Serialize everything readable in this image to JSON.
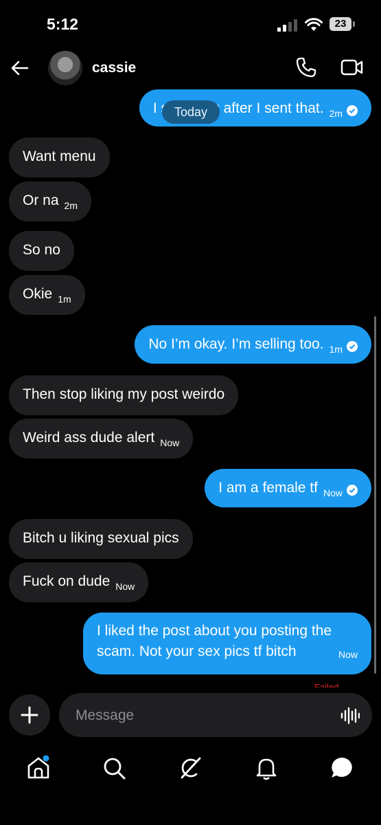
{
  "status_bar": {
    "time": "5:12",
    "battery": "23"
  },
  "header": {
    "contact_name": "cassie"
  },
  "date_divider": "Today",
  "messages": [
    {
      "dir": "out",
      "text": "I seen you after I sent that.",
      "time": "2m",
      "read": true
    },
    {
      "dir": "in",
      "text": "Want menu",
      "time": ""
    },
    {
      "dir": "in",
      "text": "Or na",
      "time": "2m"
    },
    {
      "dir": "in",
      "text": "So no",
      "time": ""
    },
    {
      "dir": "in",
      "text": "Okie",
      "time": "1m"
    },
    {
      "dir": "out",
      "text": "No I’m okay. I’m selling too.",
      "time": "1m",
      "read": true
    },
    {
      "dir": "in",
      "text": "Then stop liking my post weirdo",
      "time": ""
    },
    {
      "dir": "in",
      "text": "Weird ass dude alert",
      "time": "Now"
    },
    {
      "dir": "out",
      "text": "I am a female tf",
      "time": "Now",
      "read": true
    },
    {
      "dir": "in",
      "text": "Bitch u liking sexual pics",
      "time": ""
    },
    {
      "dir": "in",
      "text": "Fuck on dude",
      "time": "Now"
    },
    {
      "dir": "out",
      "line1": "I liked the post about you posting the",
      "line2": "scam. Not your sex pics tf bitch",
      "time": "Now"
    }
  ],
  "failed_label": "Failed",
  "composer": {
    "placeholder": "Message"
  },
  "colors": {
    "outgoing": "#1d9bf0",
    "incoming": "#1f1f22",
    "background": "#000000",
    "error": "#f4212e"
  },
  "tabs": [
    "home-icon",
    "search-icon",
    "grok-icon",
    "notifications-icon",
    "messages-icon"
  ]
}
